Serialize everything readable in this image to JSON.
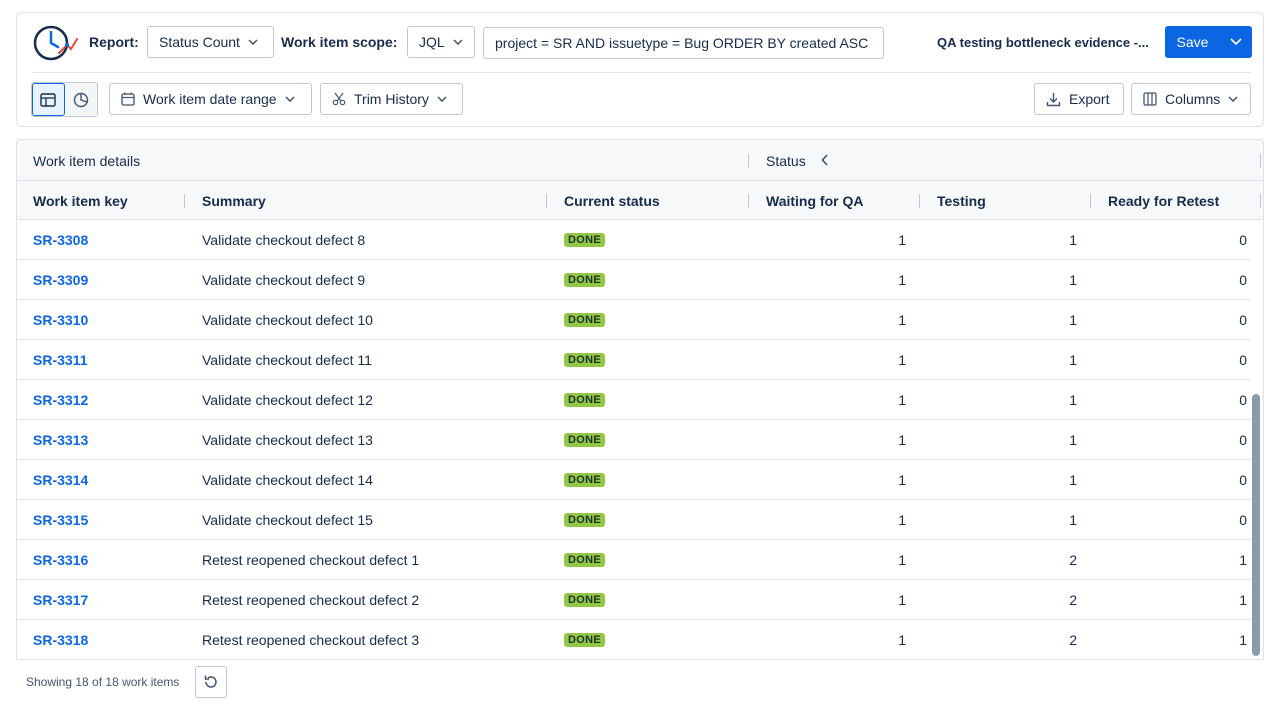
{
  "toolbar": {
    "report_label": "Report:",
    "report_value": "Status Count",
    "scope_label": "Work item scope:",
    "scope_mode": "JQL",
    "jql_query": "project = SR AND issuetype = Bug ORDER BY created ASC",
    "report_name": "QA testing bottleneck evidence -...",
    "save_label": "Save",
    "date_range_label": "Work item date range",
    "trim_history_label": "Trim History",
    "export_label": "Export",
    "columns_label": "Columns"
  },
  "table": {
    "group_headers": {
      "details": "Work item details",
      "status": "Status"
    },
    "columns": {
      "key": "Work item key",
      "summary": "Summary",
      "current_status": "Current status",
      "waiting_for_qa": "Waiting for QA",
      "testing": "Testing",
      "ready_for_retest": "Ready for Retest"
    },
    "rows": [
      {
        "key": "SR-3308",
        "summary": "Validate checkout defect 8",
        "status": "DONE",
        "waiting_for_qa": "1",
        "testing": "1",
        "ready_for_retest": "0"
      },
      {
        "key": "SR-3309",
        "summary": "Validate checkout defect 9",
        "status": "DONE",
        "waiting_for_qa": "1",
        "testing": "1",
        "ready_for_retest": "0"
      },
      {
        "key": "SR-3310",
        "summary": "Validate checkout defect 10",
        "status": "DONE",
        "waiting_for_qa": "1",
        "testing": "1",
        "ready_for_retest": "0"
      },
      {
        "key": "SR-3311",
        "summary": "Validate checkout defect 11",
        "status": "DONE",
        "waiting_for_qa": "1",
        "testing": "1",
        "ready_for_retest": "0"
      },
      {
        "key": "SR-3312",
        "summary": "Validate checkout defect 12",
        "status": "DONE",
        "waiting_for_qa": "1",
        "testing": "1",
        "ready_for_retest": "0"
      },
      {
        "key": "SR-3313",
        "summary": "Validate checkout defect 13",
        "status": "DONE",
        "waiting_for_qa": "1",
        "testing": "1",
        "ready_for_retest": "0"
      },
      {
        "key": "SR-3314",
        "summary": "Validate checkout defect 14",
        "status": "DONE",
        "waiting_for_qa": "1",
        "testing": "1",
        "ready_for_retest": "0"
      },
      {
        "key": "SR-3315",
        "summary": "Validate checkout defect 15",
        "status": "DONE",
        "waiting_for_qa": "1",
        "testing": "1",
        "ready_for_retest": "0"
      },
      {
        "key": "SR-3316",
        "summary": "Retest reopened checkout defect 1",
        "status": "DONE",
        "waiting_for_qa": "1",
        "testing": "2",
        "ready_for_retest": "1"
      },
      {
        "key": "SR-3317",
        "summary": "Retest reopened checkout defect 2",
        "status": "DONE",
        "waiting_for_qa": "1",
        "testing": "2",
        "ready_for_retest": "1"
      },
      {
        "key": "SR-3318",
        "summary": "Retest reopened checkout defect 3",
        "status": "DONE",
        "waiting_for_qa": "1",
        "testing": "2",
        "ready_for_retest": "1"
      }
    ]
  },
  "footer": {
    "count_text": "Showing 18 of 18 work items"
  },
  "colors": {
    "accent": "#0c66e4",
    "done_badge": "#94c748",
    "border": "#dfe1e6"
  }
}
